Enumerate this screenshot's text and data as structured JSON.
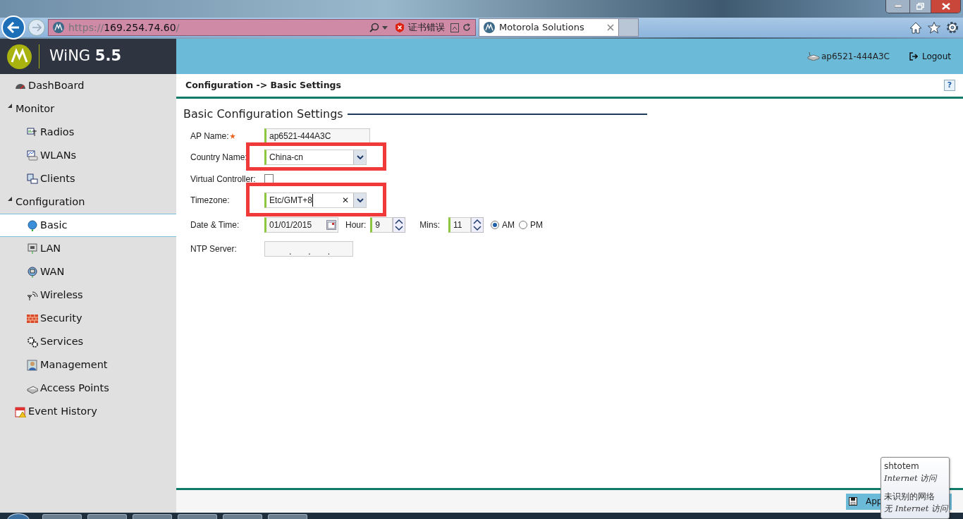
{
  "browser": {
    "address": {
      "scheme": "https://",
      "host": "169.254.74.60",
      "path": "/"
    },
    "security_label": "证书错误",
    "tabs": [
      {
        "title": "Motorola Solutions",
        "selected": true
      }
    ]
  },
  "app": {
    "logo_name": "WiNG",
    "logo_version": "5.5",
    "device": "ap6521-444A3C",
    "logout": "Logout"
  },
  "sidebar": {
    "items": [
      {
        "label": "DashBoard",
        "selected": false
      },
      {
        "label": "Monitor",
        "expanded": true,
        "selected": false,
        "children": [
          {
            "label": "Radios",
            "selected": false
          },
          {
            "label": "WLANs",
            "selected": false
          },
          {
            "label": "Clients",
            "selected": false
          }
        ]
      },
      {
        "label": "Configuration",
        "expanded": true,
        "selected": false,
        "children": [
          {
            "label": "Basic",
            "selected": true
          },
          {
            "label": "LAN",
            "selected": false
          },
          {
            "label": "WAN",
            "selected": false
          },
          {
            "label": "Wireless",
            "selected": false
          },
          {
            "label": "Security",
            "selected": false
          },
          {
            "label": "Services",
            "selected": false
          },
          {
            "label": "Management",
            "selected": false
          },
          {
            "label": "Access Points",
            "selected": false
          }
        ]
      },
      {
        "label": "Event History",
        "selected": false
      }
    ]
  },
  "breadcrumb": "Configuration -> Basic Settings",
  "help": "?",
  "section_title": "Basic Configuration Settings",
  "fields": [
    {
      "kind": "text",
      "label": "AP Name:",
      "required": true,
      "value": "ap6521-444A3C",
      "highlighted": false
    },
    {
      "kind": "select",
      "label": "Country Name:",
      "value": "China-cn",
      "highlighted": true
    },
    {
      "kind": "checkbox",
      "label": "Virtual Controller:",
      "checked": false,
      "highlighted": false
    },
    {
      "kind": "combo",
      "label": "Timezone:",
      "value": "Etc/GMT+8",
      "clear": "✕",
      "highlighted": true
    },
    {
      "kind": "datetime",
      "label": "Date & Time:",
      "date": "01/01/2015",
      "hour_label": "Hour:",
      "hour": "9",
      "mins_label": "Mins:",
      "mins": "11",
      "periods": [
        {
          "label": "AM",
          "selected": true
        },
        {
          "label": "PM",
          "selected": false
        }
      ],
      "highlighted": false
    },
    {
      "kind": "ip",
      "label": "NTP Server:",
      "dots": [
        ".",
        ".",
        "."
      ],
      "highlighted": false
    }
  ],
  "footer": {
    "apply": "App"
  },
  "tooltip": {
    "lines": [
      {
        "kind": "name",
        "text": "shtotem"
      },
      {
        "kind": "status",
        "text": "Internet 访问"
      },
      {
        "kind": "name",
        "text": "未识别的网络"
      },
      {
        "kind": "status",
        "text": "无 Internet 访问"
      }
    ]
  }
}
